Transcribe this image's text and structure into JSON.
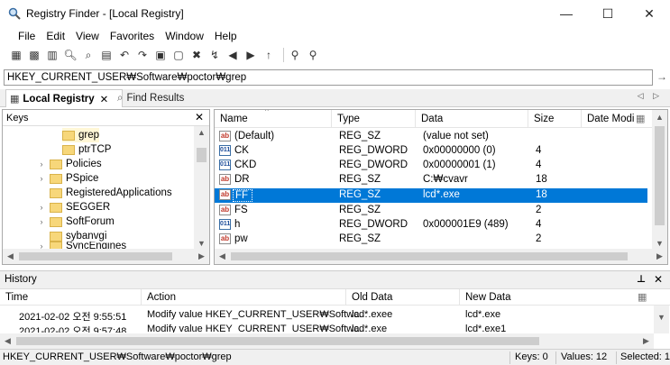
{
  "window": {
    "title": "Registry Finder - [Local Registry]",
    "controls": {
      "minimize": "—",
      "maximize": "☐",
      "close": "✕"
    }
  },
  "menu": [
    "File",
    "Edit",
    "View",
    "Favorites",
    "Window",
    "Help"
  ],
  "address": {
    "path": "HKEY_CURRENT_USER₩Software₩poctor₩grep",
    "go_glyph": "→"
  },
  "tabs": {
    "active": "Local Registry",
    "inactive": "Find Results",
    "nav": "◁ ▷"
  },
  "keys_pane": {
    "header": "Keys",
    "items": [
      {
        "label": "grep",
        "expander": ""
      },
      {
        "label": "ptrTCP",
        "expander": ""
      },
      {
        "label": "Policies",
        "expander": "›"
      },
      {
        "label": "PSpice",
        "expander": "›"
      },
      {
        "label": "RegisteredApplications",
        "expander": ""
      },
      {
        "label": "SEGGER",
        "expander": "›"
      },
      {
        "label": "SoftForum",
        "expander": "›"
      },
      {
        "label": "sybanvgi",
        "expander": ""
      },
      {
        "label": "SyncEngines",
        "expander": "›"
      }
    ]
  },
  "values_pane": {
    "columns": [
      "Name",
      "Type",
      "Data",
      "Size",
      "Date Modi"
    ],
    "rows": [
      {
        "icon": "ab",
        "name": "(Default)",
        "type": "REG_SZ",
        "data": "(value not set)",
        "size": ""
      },
      {
        "icon": "bin",
        "name": "CK",
        "type": "REG_DWORD",
        "data": "0x00000000 (0)",
        "size": "4"
      },
      {
        "icon": "bin",
        "name": "CKD",
        "type": "REG_DWORD",
        "data": "0x00000001 (1)",
        "size": "4"
      },
      {
        "icon": "ab",
        "name": "DR",
        "type": "REG_SZ",
        "data": "C:₩cvavr",
        "size": "18"
      },
      {
        "icon": "ab",
        "name": "FF",
        "type": "REG_SZ",
        "data": "lcd*.exe",
        "size": "18",
        "selected": true
      },
      {
        "icon": "ab",
        "name": "FS",
        "type": "REG_SZ",
        "data": "",
        "size": "2"
      },
      {
        "icon": "bin",
        "name": "h",
        "type": "REG_DWORD",
        "data": "0x000001E9 (489)",
        "size": "4"
      },
      {
        "icon": "ab",
        "name": "pw",
        "type": "REG_SZ",
        "data": "",
        "size": "2"
      }
    ]
  },
  "history": {
    "header": "History",
    "pin_glyph": "📌",
    "columns": [
      "Time",
      "Action",
      "Old Data",
      "New Data"
    ],
    "rows": [
      {
        "time": "2021-02-02 오전 9:55:51",
        "action": "Modify value HKEY_CURRENT_USER₩Softwa...",
        "old": "lcd*.exee",
        "new": "lcd*.exe"
      },
      {
        "time": "2021-02-02 오전 9:57:48",
        "action": "Modify value HKEY_CURRENT_USER₩Softwa...",
        "old": "lcd*.exe",
        "new": "lcd*.exe1"
      }
    ]
  },
  "status": {
    "path": "HKEY_CURRENT_USER₩Software₩poctor₩grep",
    "keys": "Keys: 0",
    "values": "Values: 12",
    "selected": "Selected: 1"
  },
  "colors": {
    "selection": "#0078d7",
    "folder": "#f7d77a"
  }
}
